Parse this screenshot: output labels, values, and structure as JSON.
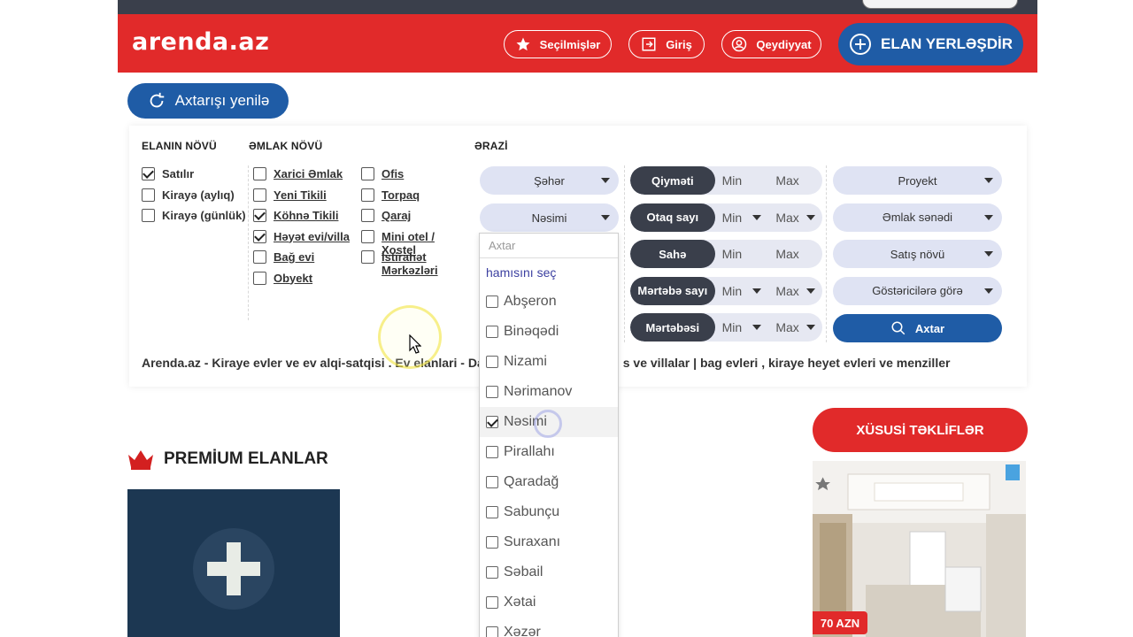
{
  "header": {
    "logo": "arenda.az",
    "favorites_label": "Seçilmişlər",
    "login_label": "Giriş",
    "register_label": "Qeydiyyat",
    "post_ad_label": "ELAN YERLƏŞDİR"
  },
  "refresh_label": "Axtarışı yenilə",
  "filters": {
    "listing_type": {
      "title": "ELANIN NÖVÜ",
      "items": [
        {
          "label": "Satılır",
          "checked": true
        },
        {
          "label": "Kirayə (aylıq)",
          "checked": false
        },
        {
          "label": "Kirayə (günlük)",
          "checked": false
        }
      ]
    },
    "property_type": {
      "title": "ƏMLAK NÖVÜ",
      "col1": [
        {
          "label": "Xarici Əmlak",
          "checked": false
        },
        {
          "label": "Yeni Tikili",
          "checked": false
        },
        {
          "label": "Köhnə Tikili",
          "checked": true
        },
        {
          "label": "Həyət evi/villa",
          "checked": true
        },
        {
          "label": "Bağ evi",
          "checked": false
        },
        {
          "label": "Obyekt",
          "checked": false
        }
      ],
      "col2": [
        {
          "label": "Ofis",
          "checked": false
        },
        {
          "label": "Torpaq",
          "checked": false
        },
        {
          "label": "Qaraj",
          "checked": false
        },
        {
          "label": "Mini otel / Xostel",
          "checked": false
        },
        {
          "label": "İstirahət Mərkəzləri",
          "checked": false
        }
      ]
    },
    "area": {
      "title": "ƏRAZİ",
      "city_select": "Şəhər",
      "district_select": "Nəsimi"
    },
    "ranges": [
      {
        "label": "Qiyməti",
        "min": "Min",
        "max": "Max",
        "dropdown": false
      },
      {
        "label": "Otaq sayı",
        "min": "Min",
        "max": "Max",
        "dropdown": true
      },
      {
        "label": "Sahə",
        "min": "Min",
        "max": "Max",
        "dropdown": false
      },
      {
        "label": "Mərtəbə sayı",
        "min": "Min",
        "max": "Max",
        "dropdown": true
      },
      {
        "label": "Mərtəbəsi",
        "min": "Min",
        "max": "Max",
        "dropdown": true
      }
    ],
    "right_selects": [
      "Proyekt",
      "Əmlak sənədi",
      "Satış növü",
      "Göstəricilərə görə"
    ],
    "search_label": "Axtar"
  },
  "seo_text": "Arenda.az - Kiraye evler ve ev alqi-satqisi . Ev elanlari - Da",
  "seo_text_tail": "s ve villalar | bag evleri , kiraye heyet evleri ve menziller",
  "district_dropdown": {
    "search_placeholder": "Axtar",
    "select_all": "hamısını seç",
    "items": [
      {
        "label": "Abşeron",
        "checked": false
      },
      {
        "label": "Binəqədi",
        "checked": false
      },
      {
        "label": "Nizami",
        "checked": false
      },
      {
        "label": "Nərimanov",
        "checked": false
      },
      {
        "label": "Nəsimi",
        "checked": true
      },
      {
        "label": "Pirallahı",
        "checked": false
      },
      {
        "label": "Qaradağ",
        "checked": false
      },
      {
        "label": "Sabunçu",
        "checked": false
      },
      {
        "label": "Suraxanı",
        "checked": false
      },
      {
        "label": "Səbail",
        "checked": false
      },
      {
        "label": "Xətai",
        "checked": false
      },
      {
        "label": "Xəzər",
        "checked": false
      }
    ]
  },
  "premium": {
    "title": "PREMİUM ELANLAR"
  },
  "special": {
    "title": "XÜSUSİ TƏKLİFLƏR",
    "price": "70 AZN"
  },
  "colors": {
    "brand_red": "#e12a2a",
    "brand_blue": "#1f5ca6",
    "dark": "#3a3f4b"
  }
}
